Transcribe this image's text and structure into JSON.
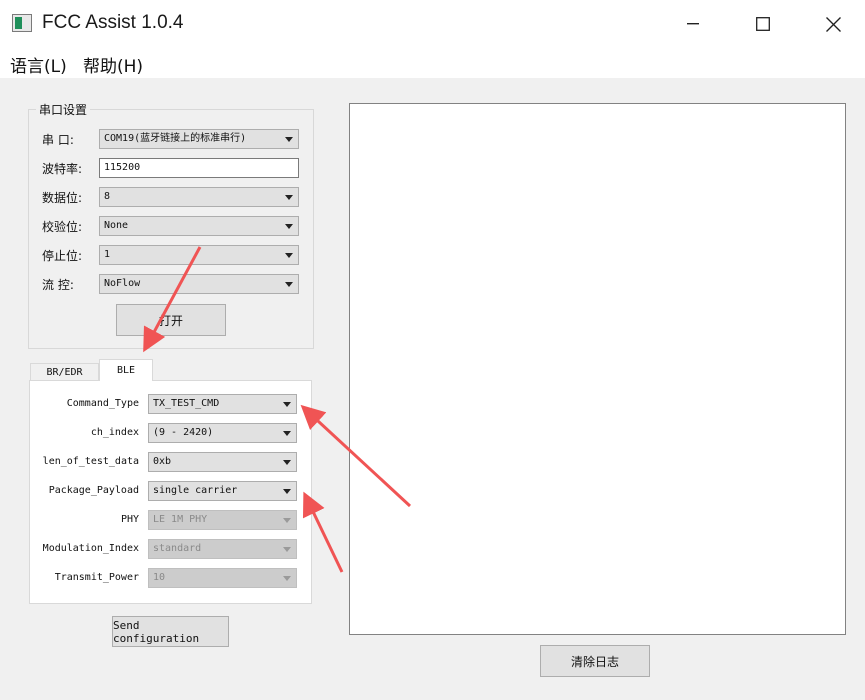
{
  "window": {
    "title": "FCC Assist 1.0.4",
    "minimize_icon": "minimize-icon",
    "maximize_icon": "maximize-icon",
    "close_icon": "close-icon"
  },
  "menu": {
    "language": "语言(L)",
    "help": "帮助(H)"
  },
  "serial": {
    "group_title": "串口设置",
    "port_label": "串  口:",
    "port_value": "COM19(蓝牙链接上的标准串行)",
    "baud_label": "波特率:",
    "baud_value": "115200",
    "databits_label": "数据位:",
    "databits_value": "8",
    "parity_label": "校验位:",
    "parity_value": "None",
    "stopbits_label": "停止位:",
    "stopbits_value": "1",
    "flow_label": "流  控:",
    "flow_value": "NoFlow",
    "open_button": "打开"
  },
  "tabs": {
    "br_edr": "BR/EDR",
    "ble": "BLE"
  },
  "ble": {
    "command_type_label": "Command_Type",
    "command_type_value": "TX_TEST_CMD",
    "ch_index_label": "ch_index",
    "ch_index_value": "(9 - 2420)",
    "len_label": "len_of_test_data",
    "len_value": "0xb",
    "payload_label": "Package_Payload",
    "payload_value": "single carrier",
    "phy_label": "PHY",
    "phy_value": "LE 1M PHY",
    "modulation_label": "Modulation_Index",
    "modulation_value": "standard",
    "power_label": "Transmit_Power",
    "power_value": "10"
  },
  "buttons": {
    "send_configuration": "Send configuration",
    "clear_log": "清除日志"
  },
  "annotation": {
    "arrow_color": "#f05454"
  }
}
